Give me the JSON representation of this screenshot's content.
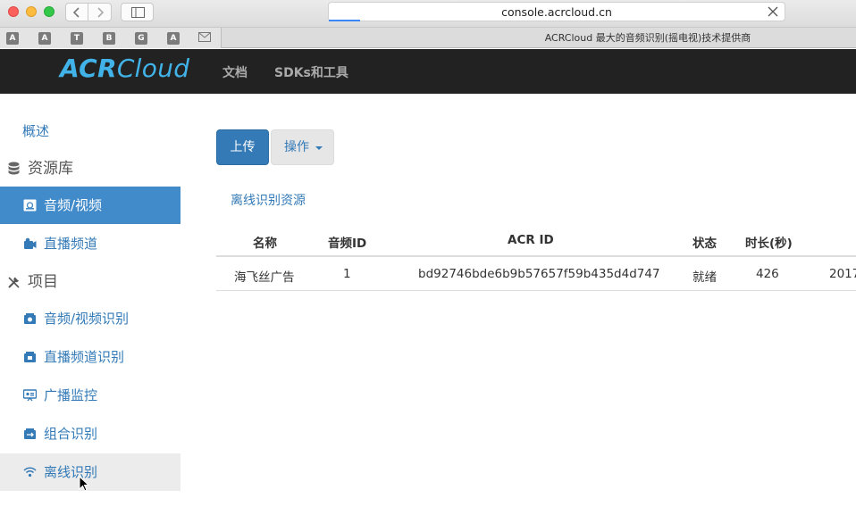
{
  "browser": {
    "url": "console.acrcloud.cn",
    "tab_title": "ACRCloud 最大的音频识别(摇电视)技术提供商",
    "extensions": [
      "A",
      "A",
      "T",
      "B",
      "G",
      "A",
      "mail"
    ]
  },
  "header": {
    "logo_bold": "ACR",
    "logo_regular": "Cloud",
    "nav": [
      "文档",
      "SDKs和工具"
    ]
  },
  "sidebar": {
    "overview": "概述",
    "resources_heading": "资源库",
    "resources": [
      {
        "label": "音频/视频",
        "icon": "media-icon"
      },
      {
        "label": "直播频道",
        "icon": "channel-icon"
      }
    ],
    "projects_heading": "项目",
    "projects": [
      {
        "label": "音频/视频识别",
        "icon": "media-recognition-icon"
      },
      {
        "label": "直播频道识别",
        "icon": "channel-recognition-icon"
      },
      {
        "label": "广播监控",
        "icon": "broadcast-monitor-icon"
      },
      {
        "label": "组合识别",
        "icon": "combined-recognition-icon"
      },
      {
        "label": "离线识别",
        "icon": "offline-recognition-icon"
      }
    ]
  },
  "main": {
    "upload_label": "上传",
    "action_label": "操作",
    "section_link": "离线识别资源",
    "table": {
      "headers": [
        "名称",
        "音频ID",
        "ACR ID",
        "状态",
        "时长(秒)"
      ],
      "rows": [
        [
          "海飞丝广告",
          "1",
          "bd92746bde6b9b57657f59b435d4d747",
          "就绪",
          "426",
          "2017"
        ]
      ]
    }
  },
  "colors": {
    "accent": "#337ab7",
    "active_bg": "#428bca",
    "header_bg": "#222222",
    "logo": "#41b3e8"
  }
}
